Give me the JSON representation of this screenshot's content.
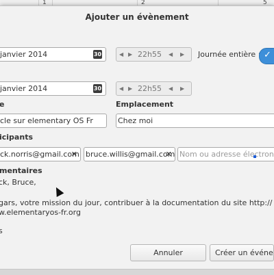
{
  "background": {
    "col_numbers": [
      "1",
      "2",
      "5"
    ]
  },
  "dialog": {
    "title": "Ajouter un évènement",
    "start": {
      "date": "janvier 2014",
      "calendar_day": "30",
      "time": "22h55"
    },
    "all_day_label": "Journée entière :",
    "all_day_checked": true,
    "end": {
      "date": "janvier 2014",
      "calendar_day": "30",
      "time": "22h55"
    },
    "title_label": "e",
    "title_value": "cle sur elementary OS Fr",
    "location_label": "Emplacement",
    "location_value": "Chez moi",
    "participants_label": "icipants",
    "participants": [
      "ck.norris@gmail.com",
      "bruce.willis@gmail.com"
    ],
    "participants_placeholder": "Nom ou adresse électroniqu",
    "comments_label": "mentaires",
    "comments_lines": [
      "ck, Bruce,",
      "",
      "gars, votre mission du jour, contribuer à la documentation du site http://",
      "w.elementaryos-fr.org",
      "",
      "s"
    ],
    "buttons": {
      "cancel": "Annuler",
      "create": "Créer un événeme"
    }
  },
  "colors": {
    "accent": "#3d8fd9"
  },
  "icons": [
    "calendar-icon",
    "checkmark-icon",
    "remove-x-icon",
    "arrow-left-icon",
    "arrow-right-icon",
    "mouse-cursor-icon"
  ]
}
